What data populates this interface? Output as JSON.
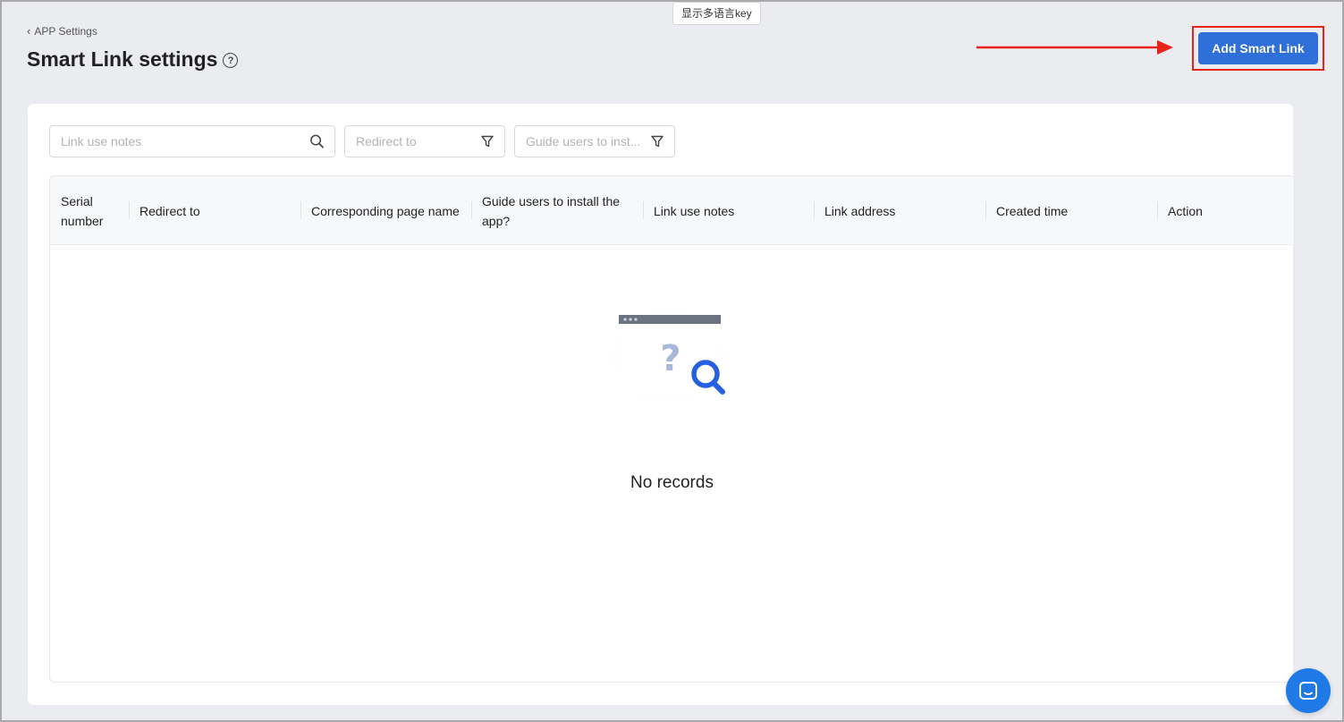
{
  "lang_chip": "显示多语言key",
  "breadcrumb": {
    "back_label": "APP Settings"
  },
  "page": {
    "title": "Smart Link settings",
    "help_icon": "question-circle-icon"
  },
  "toolbar": {
    "add_button_label": "Add Smart Link"
  },
  "annotation": {
    "color": "#e8231b"
  },
  "filters": {
    "notes_placeholder": "Link use notes",
    "redirect_placeholder": "Redirect to",
    "guide_placeholder": "Guide users to inst..."
  },
  "table": {
    "columns": [
      "Serial number",
      "Redirect to",
      "Corresponding page name",
      "Guide users to install the app?",
      "Link use notes",
      "Link address",
      "Created time",
      "Action"
    ],
    "rows": [],
    "empty_text": "No records"
  },
  "colors": {
    "primary": "#2f6fd9",
    "chat": "#1f7ae8"
  }
}
